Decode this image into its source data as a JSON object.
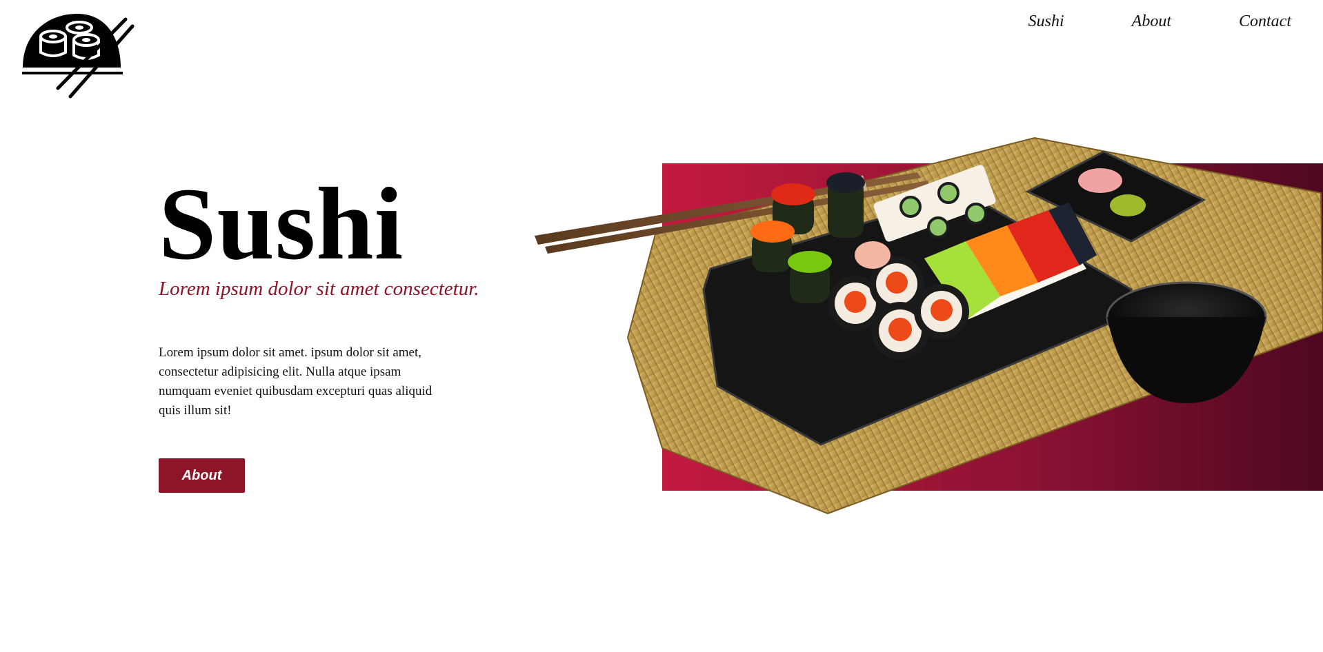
{
  "header": {
    "nav": [
      {
        "label": "Sushi"
      },
      {
        "label": "About"
      },
      {
        "label": "Contact"
      }
    ]
  },
  "hero": {
    "title": "Sushi",
    "subtitle": "Lorem ipsum dolor sit amet consectetur.",
    "body": "Lorem ipsum dolor sit amet. ipsum dolor sit amet, consectetur adipisicing elit. Nulla atque ipsam numquam eveniet quibusdam excepturi quas aliquid quis illum sit!",
    "button_label": "About"
  },
  "colors": {
    "accent": "#8e1428",
    "gradient_start": "#c31a3f",
    "gradient_end": "#4e0820"
  },
  "icons": {
    "logo": "sushi-chopsticks-logo-icon"
  }
}
